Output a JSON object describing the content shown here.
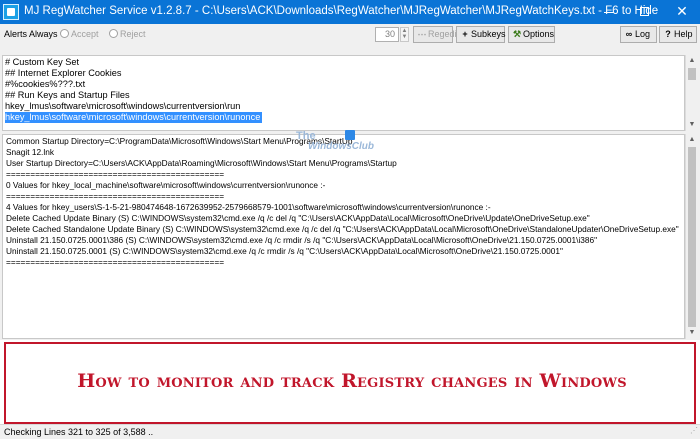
{
  "window": {
    "title": "MJ RegWatcher Service v1.2.8.7 - C:\\Users\\ACK\\Downloads\\RegWatcher\\MJRegWatcher\\MJRegWatchKeys.txt - F6 to Hide",
    "close_glyph": "✕"
  },
  "toolbar": {
    "alerts_label": "Alerts Always",
    "accept_label": "Accept",
    "reject_label": "Reject",
    "interval_value": "30",
    "regedit_label": "Regedit",
    "subkeys_label": "Subkeys",
    "options_label": "Options",
    "log_label": "Log",
    "help_label": "Help"
  },
  "keyset": {
    "lines": [
      "# Custom Key Set",
      "## Internet Explorer Cookies",
      "#%cookies%???.txt",
      "## Run Keys and Startup Files",
      "hkey_lmus\\software\\microsoft\\windows\\currentversion\\run",
      "hkey_lmus\\software\\microsoft\\windows\\currentversion\\runonce"
    ],
    "selected_line_index": 5
  },
  "output": {
    "lines": [
      "Common Startup Directory=C:\\ProgramData\\Microsoft\\Windows\\Start Menu\\Programs\\StartUp",
      "Snagit 12.lnk",
      "User Startup Directory=C:\\Users\\ACK\\AppData\\Roaming\\Microsoft\\Windows\\Start Menu\\Programs\\Startup",
      "=============================================",
      "0 Values for hkey_local_machine\\software\\microsoft\\windows\\currentversion\\runonce :-",
      "=============================================",
      "4 Values for hkey_users\\S-1-5-21-980474648-1672639952-2579668579-1001\\software\\microsoft\\windows\\currentversion\\runonce :-",
      "Delete Cached Update Binary (S) C:\\WINDOWS\\system32\\cmd.exe /q /c del /q \"C:\\Users\\ACK\\AppData\\Local\\Microsoft\\OneDrive\\Update\\OneDriveSetup.exe\"",
      "Delete Cached Standalone Update Binary (S) C:\\WINDOWS\\system32\\cmd.exe /q /c del /q \"C:\\Users\\ACK\\AppData\\Local\\Microsoft\\OneDrive\\StandaloneUpdater\\OneDriveSetup.exe\"",
      "Uninstall 21.150.0725.0001\\386 (S) C:\\WINDOWS\\system32\\cmd.exe /q /c rmdir /s /q \"C:\\Users\\ACK\\AppData\\Local\\Microsoft\\OneDrive\\21.150.0725.0001\\i386\"",
      "Uninstall 21.150.0725.0001 (S) C:\\WINDOWS\\system32\\cmd.exe /q /c rmdir /s /q \"C:\\Users\\ACK\\AppData\\Local\\Microsoft\\OneDrive\\21.150.0725.0001\"",
      "============================================="
    ]
  },
  "watermark": {
    "line1": "The",
    "line2": "WindowsClub"
  },
  "banner": {
    "text": "How to monitor and track Registry changes in Windows",
    "color": "#c1162b"
  },
  "status": {
    "text": "Checking Lines 321 to 325 of 3,588 .."
  },
  "colors": {
    "titlebar": "#0a74d6",
    "selection": "#3390ff"
  }
}
